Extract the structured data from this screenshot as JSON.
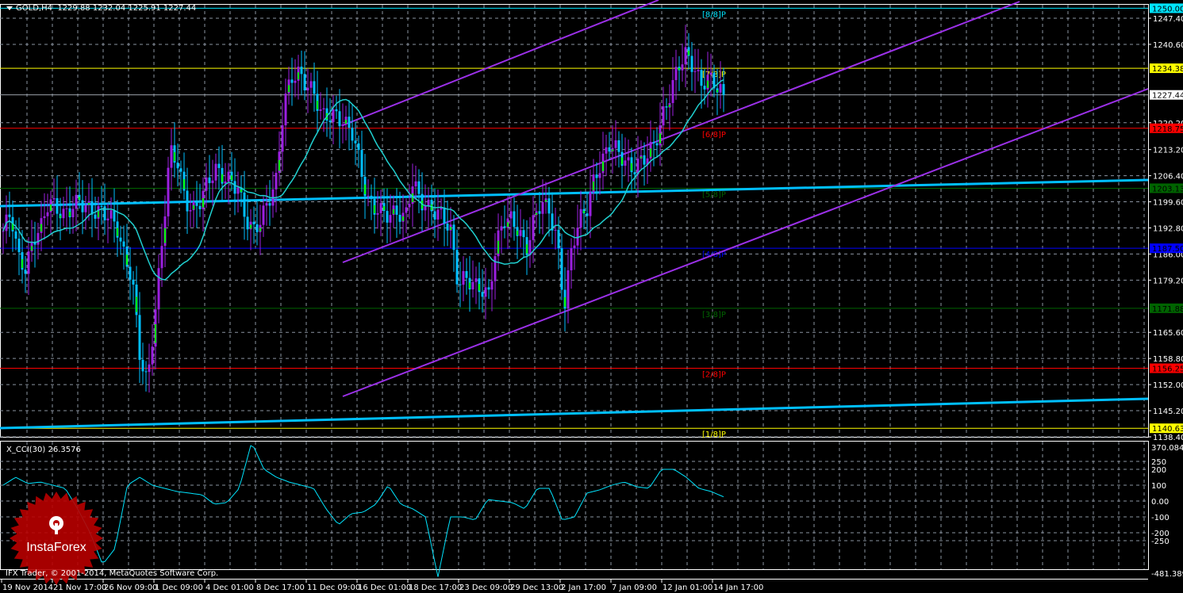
{
  "header": {
    "symbol": "GOLD,H4",
    "ohlc": "1229.88 1232.04 1225.91 1227.44"
  },
  "indicator": {
    "title": "X_CCI(30) 26.3576"
  },
  "copyright": "IFX Trader, © 2001-2014, MetaQuotes Software Corp.",
  "logo": {
    "text": "InstaForex",
    "color": "#c00000"
  },
  "colors": {
    "background": "#000000",
    "bull": "#9b1fe0",
    "bear": "#00bfff",
    "accent": "#00ff00",
    "ma": "#20d0d0",
    "channel": "#9b30e8",
    "trend": "#00bfff",
    "grid": "#8a93a0"
  },
  "chart_data": [
    {
      "type": "candlestick",
      "symbol": "GOLD",
      "timeframe": "H4",
      "ylim": [
        1138.4,
        1250.0
      ],
      "y_ticks": [
        "1247.40",
        "1240.60",
        "1220.20",
        "1213.20",
        "1206.40",
        "1199.60",
        "1192.80",
        "1186.00",
        "1179.20",
        "1165.60",
        "1158.80",
        "1152.00",
        "1145.20",
        "1138.40"
      ],
      "x_ticks": [
        "19 Nov 2014",
        "21 Nov 17:00",
        "26 Nov 09:00",
        "1 Dec 09:00",
        "4 Dec 01:00",
        "8 Dec 17:00",
        "11 Dec 09:00",
        "16 Dec 01:00",
        "18 Dec 17:00",
        "23 Dec 09:00",
        "29 Dec 13:00",
        "2 Jan 17:00",
        "7 Jan 09:00",
        "12 Jan 01:00",
        "14 Jan 17:00"
      ],
      "closes_sampled": [
        1192,
        1197,
        1185,
        1182,
        1190,
        1193,
        1200,
        1198,
        1196,
        1198,
        1200,
        1198,
        1197,
        1197,
        1196,
        1193,
        1185,
        1180,
        1160,
        1152,
        1170,
        1190,
        1213,
        1210,
        1200,
        1197,
        1200,
        1205,
        1208,
        1206,
        1205,
        1203,
        1195,
        1192,
        1195,
        1200,
        1205,
        1225,
        1232,
        1233,
        1230,
        1228,
        1222,
        1222,
        1222,
        1220,
        1218,
        1210,
        1200,
        1198,
        1197,
        1196,
        1197,
        1195,
        1205,
        1200,
        1198,
        1197,
        1196,
        1192,
        1178,
        1180,
        1178,
        1177,
        1175,
        1188,
        1195,
        1195,
        1192,
        1187,
        1195,
        1200,
        1197,
        1190,
        1172,
        1188,
        1195,
        1198,
        1206,
        1210,
        1215,
        1213,
        1210,
        1208,
        1210,
        1212,
        1215,
        1222,
        1228,
        1235,
        1238,
        1235,
        1230,
        1232,
        1230,
        1227.44
      ],
      "last_price": "1227.44",
      "levels": [
        {
          "label": "[8/8]P",
          "price": "1250.00",
          "color": "#00e5ff"
        },
        {
          "label": "[7/8]P",
          "price": "1234.38",
          "color": "#ffff00"
        },
        {
          "label": "[6/8]P",
          "price": "1218.75",
          "color": "#ff0000"
        },
        {
          "label": "[5/8]P",
          "price": "1203.13",
          "color": "#006400"
        },
        {
          "label": "[4/8]P",
          "price": "1187.50",
          "color": "#0000ff"
        },
        {
          "label": "[3/8]P",
          "price": "1171.88",
          "color": "#006400"
        },
        {
          "label": "[2/8]P",
          "price": "1156.25",
          "color": "#ff0000"
        },
        {
          "label": "[1/8]P",
          "price": "1140.63",
          "color": "#ffff00"
        }
      ]
    },
    {
      "type": "line",
      "title": "X_CCI(30) 26.3576",
      "ylim": [
        -481.3897,
        370.084
      ],
      "y_ticks": [
        "370.084",
        "250",
        "200",
        "100",
        "0.00",
        "-100",
        "-200",
        "-250",
        "-481.3897"
      ],
      "values_sampled": [
        100,
        150,
        110,
        120,
        100,
        80,
        -50,
        -200,
        -400,
        -300,
        100,
        150,
        100,
        80,
        60,
        50,
        40,
        -20,
        -10,
        80,
        370,
        200,
        150,
        120,
        100,
        80,
        -50,
        -150,
        -80,
        -70,
        -20,
        100,
        -20,
        -50,
        -100,
        -480,
        -100,
        -100,
        -120,
        10,
        0,
        -10,
        -50,
        80,
        80,
        -120,
        -100,
        50,
        70,
        100,
        120,
        90,
        80,
        200,
        200,
        150,
        80,
        60,
        26.36
      ]
    }
  ]
}
